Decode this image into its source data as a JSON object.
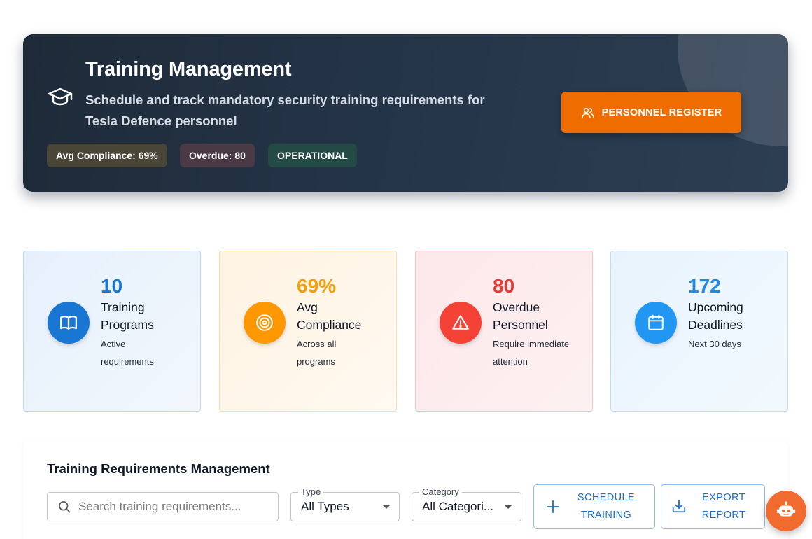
{
  "hero": {
    "title": "Training Management",
    "subtitle": "Schedule and track mandatory security training requirements for Tesla Defence personnel",
    "chips": {
      "compliance": "Avg Compliance: 69%",
      "overdue": "Overdue: 80",
      "status": "OPERATIONAL"
    },
    "register_button": "PERSONNEL REGISTER",
    "icon": "graduation-cap-icon"
  },
  "stats": [
    {
      "value": "10",
      "label": "Training Programs",
      "desc": "Active requirements",
      "icon": "book-icon",
      "color": "#1976d2",
      "icon_bg": "#1976d2"
    },
    {
      "value": "69%",
      "label": "Avg Compliance",
      "desc": "Across all programs",
      "icon": "target-icon",
      "color": "#f59e0b",
      "icon_bg": "#ff9800"
    },
    {
      "value": "80",
      "label": "Overdue Personnel",
      "desc": "Require immediate attention",
      "icon": "warning-icon",
      "color": "#e53935",
      "icon_bg": "#f44336"
    },
    {
      "value": "172",
      "label": "Upcoming Deadlines",
      "desc": "Next 30 days",
      "icon": "calendar-icon",
      "color": "#1e88e5",
      "icon_bg": "#2196f3"
    }
  ],
  "management": {
    "title": "Training Requirements Management",
    "search_placeholder": "Search training requirements...",
    "type_label": "Type",
    "type_value": "All Types",
    "category_label": "Category",
    "category_value": "All Categori...",
    "schedule_button": "SCHEDULE TRAINING",
    "export_button": "EXPORT REPORT"
  },
  "assistant": {
    "icon": "robot-icon"
  },
  "colors": {
    "accent": "#ef6c00",
    "primary": "#1c6fd0",
    "hero_bg": "#243447"
  }
}
